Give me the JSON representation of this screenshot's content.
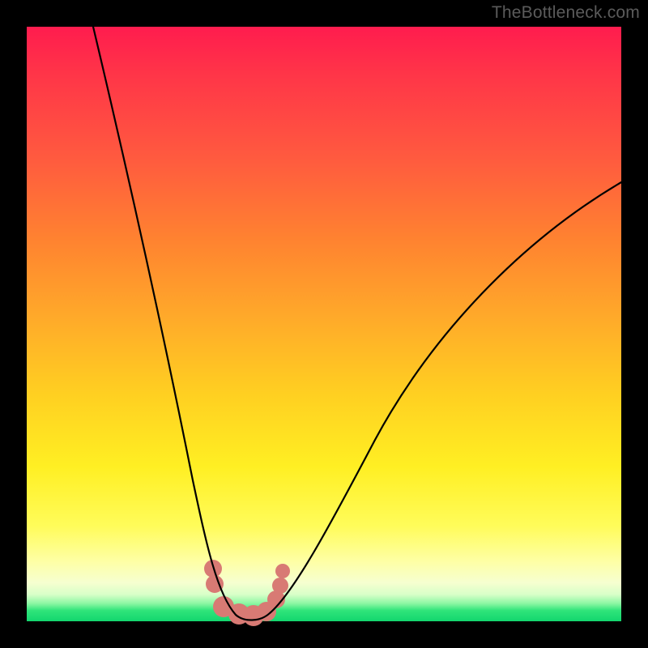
{
  "watermark": "TheBottleneck.com",
  "colors": {
    "frame": "#000000",
    "gradient_top": "#ff1c4e",
    "gradient_bottom": "#13d66e",
    "curve": "#000000",
    "bump": "#d87a74"
  },
  "chart_data": {
    "type": "line",
    "title": "",
    "xlabel": "",
    "ylabel": "",
    "xlim": [
      0,
      100
    ],
    "ylim": [
      0,
      100
    ],
    "grid": false,
    "legend": false,
    "annotations": [
      "TheBottleneck.com"
    ],
    "note": "No axes, ticks, or numeric labels are rendered; values are estimated from pixel positions on a 0–100 normalized scale.",
    "series": [
      {
        "name": "left-branch",
        "x": [
          11,
          14,
          17,
          20,
          23,
          26,
          28,
          30,
          31.5,
          33
        ],
        "y": [
          100,
          83,
          66,
          50,
          35,
          22,
          13,
          7,
          3,
          0
        ]
      },
      {
        "name": "valley-floor",
        "x": [
          33,
          35,
          37,
          39,
          41
        ],
        "y": [
          0,
          0,
          0,
          0,
          0
        ]
      },
      {
        "name": "right-branch",
        "x": [
          41,
          45,
          50,
          56,
          63,
          71,
          80,
          90,
          100
        ],
        "y": [
          0,
          6,
          15,
          26,
          38,
          50,
          60,
          68,
          74
        ]
      }
    ],
    "markers": {
      "name": "valley-bumps",
      "color": "#d87a74",
      "points": [
        {
          "x": 31.5,
          "y": 8
        },
        {
          "x": 31.8,
          "y": 5
        },
        {
          "x": 33.0,
          "y": 1.5
        },
        {
          "x": 35.0,
          "y": 0.5
        },
        {
          "x": 37.0,
          "y": 0.5
        },
        {
          "x": 39.0,
          "y": 0.8
        },
        {
          "x": 41.0,
          "y": 2.5
        },
        {
          "x": 42.0,
          "y": 5
        },
        {
          "x": 42.5,
          "y": 8
        }
      ]
    }
  }
}
